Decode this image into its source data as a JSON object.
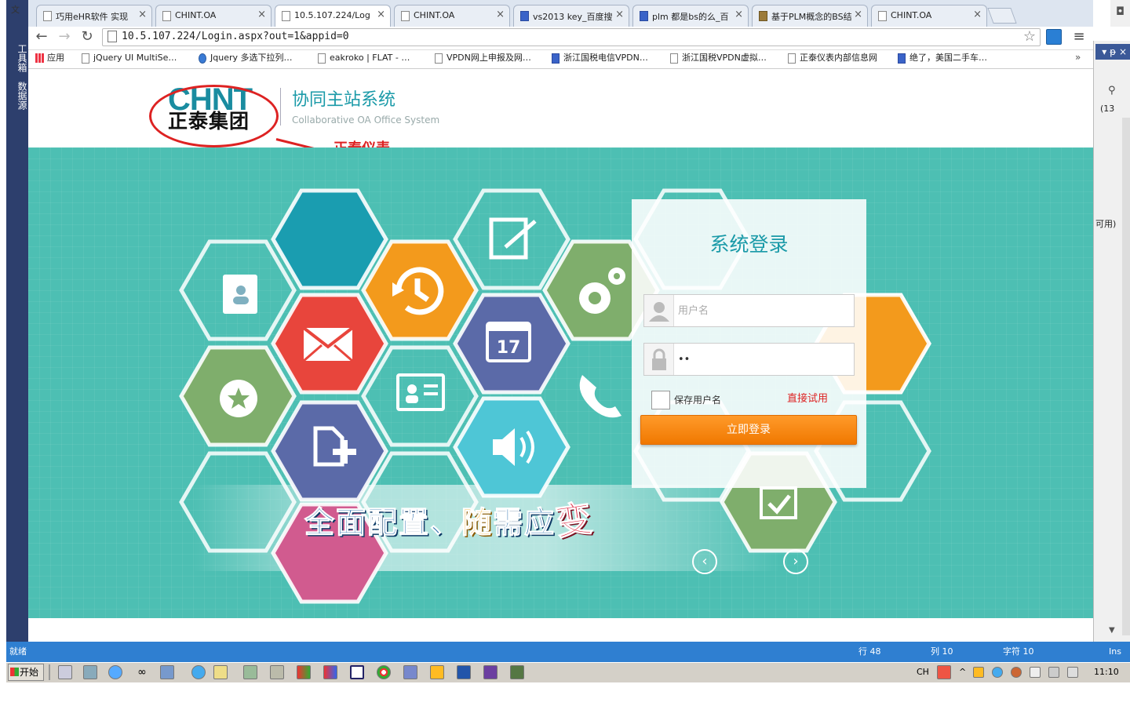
{
  "vs": {
    "corner_char": "文",
    "left_tabs": [
      "工具箱",
      "数据源"
    ],
    "right_lines": [
      "(13",
      "可用)"
    ],
    "status_ready": "就绪",
    "status_row": "行 48",
    "status_col": "列 10",
    "status_char": "字符 10",
    "status_ins": "Ins"
  },
  "browser": {
    "tabs": [
      {
        "title": "巧用eHR软件 实现",
        "active": false,
        "icon": "page-icon"
      },
      {
        "title": "CHINT.OA",
        "active": false,
        "icon": "page-icon"
      },
      {
        "title": "10.5.107.224/Log",
        "active": true,
        "icon": "page-icon"
      },
      {
        "title": "CHINT.OA",
        "active": false,
        "icon": "chint-icon"
      },
      {
        "title": "vs2013 key_百度搜",
        "active": false,
        "icon": "baidu-icon"
      },
      {
        "title": "plm 都是bs的么_百",
        "active": false,
        "icon": "baidu-icon"
      },
      {
        "title": "基于PLM概念的BS结",
        "active": false,
        "icon": "doc-icon"
      },
      {
        "title": "CHINT.OA",
        "active": false,
        "icon": "chint-icon"
      }
    ],
    "url": "10.5.107.224/Login.aspx?out=1&appid=0",
    "bookmarks": [
      {
        "label": "应用",
        "icon": "apps"
      },
      {
        "label": "jQuery UI MultiSe…",
        "icon": "page"
      },
      {
        "label": "Jquery 多选下拉列…",
        "icon": "circle"
      },
      {
        "label": "eakroko | FLAT - …",
        "icon": "page"
      },
      {
        "label": "VPDN网上申报及网…",
        "icon": "page"
      },
      {
        "label": "浙江国税电信VPDN…",
        "icon": "baidu"
      },
      {
        "label": "浙江国税VPDN虚拟…",
        "icon": "page"
      },
      {
        "label": "正泰仪表内部信息网",
        "icon": "page"
      },
      {
        "label": "绝了，美国二手车…",
        "icon": "baidu"
      }
    ],
    "more": "»"
  },
  "page": {
    "logo_en": "CHNT",
    "logo_cn": "正泰集团",
    "title": "协同主站系统",
    "subtitle": "Collaborative OA Office System",
    "annotation": "正泰仪表",
    "slogan": {
      "a": "全面配置、",
      "b": "随",
      "c": "需应",
      "d": "变"
    },
    "calendar_day": "17",
    "login": {
      "title": "系统登录",
      "username_placeholder": "用户名",
      "username_value": "",
      "password_value": "••",
      "remember_label": "保存用户名",
      "try_link": "直接试用",
      "submit": "立即登录"
    }
  },
  "taskbar": {
    "start": "开始",
    "lang": "CH",
    "time": "11:10"
  },
  "colors": {
    "teal_bg": "#4dbfb3",
    "accent": "#1a9aa8",
    "login_btn": "#f58a0b",
    "annotation": "#dd2222",
    "status_bar": "#2f7fd1"
  }
}
